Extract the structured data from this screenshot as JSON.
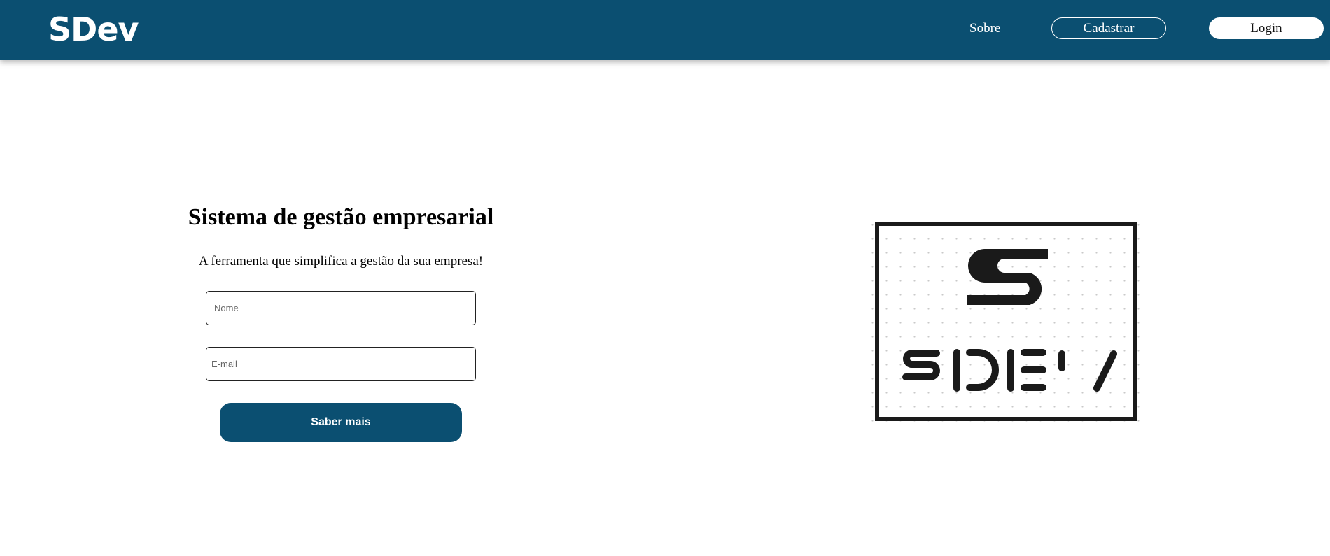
{
  "navbar": {
    "brand": "SDev",
    "links": {
      "about": "Sobre"
    },
    "register_label": "Cadastrar",
    "login_label": "Login",
    "background_color": "#0b4f71"
  },
  "hero": {
    "title": "Sistema de gestão empresarial",
    "subtitle": "A ferramenta que simplifica a gestão da sua empresa!",
    "form": {
      "name_placeholder": "Nome",
      "name_value": "",
      "email_placeholder": "E-mail",
      "email_value": "",
      "submit_label": "Saber mais"
    }
  },
  "logo": {
    "mark": "S",
    "wordmark": [
      "S",
      "D",
      "E",
      "V"
    ],
    "ink_color": "#1a1a1a"
  }
}
